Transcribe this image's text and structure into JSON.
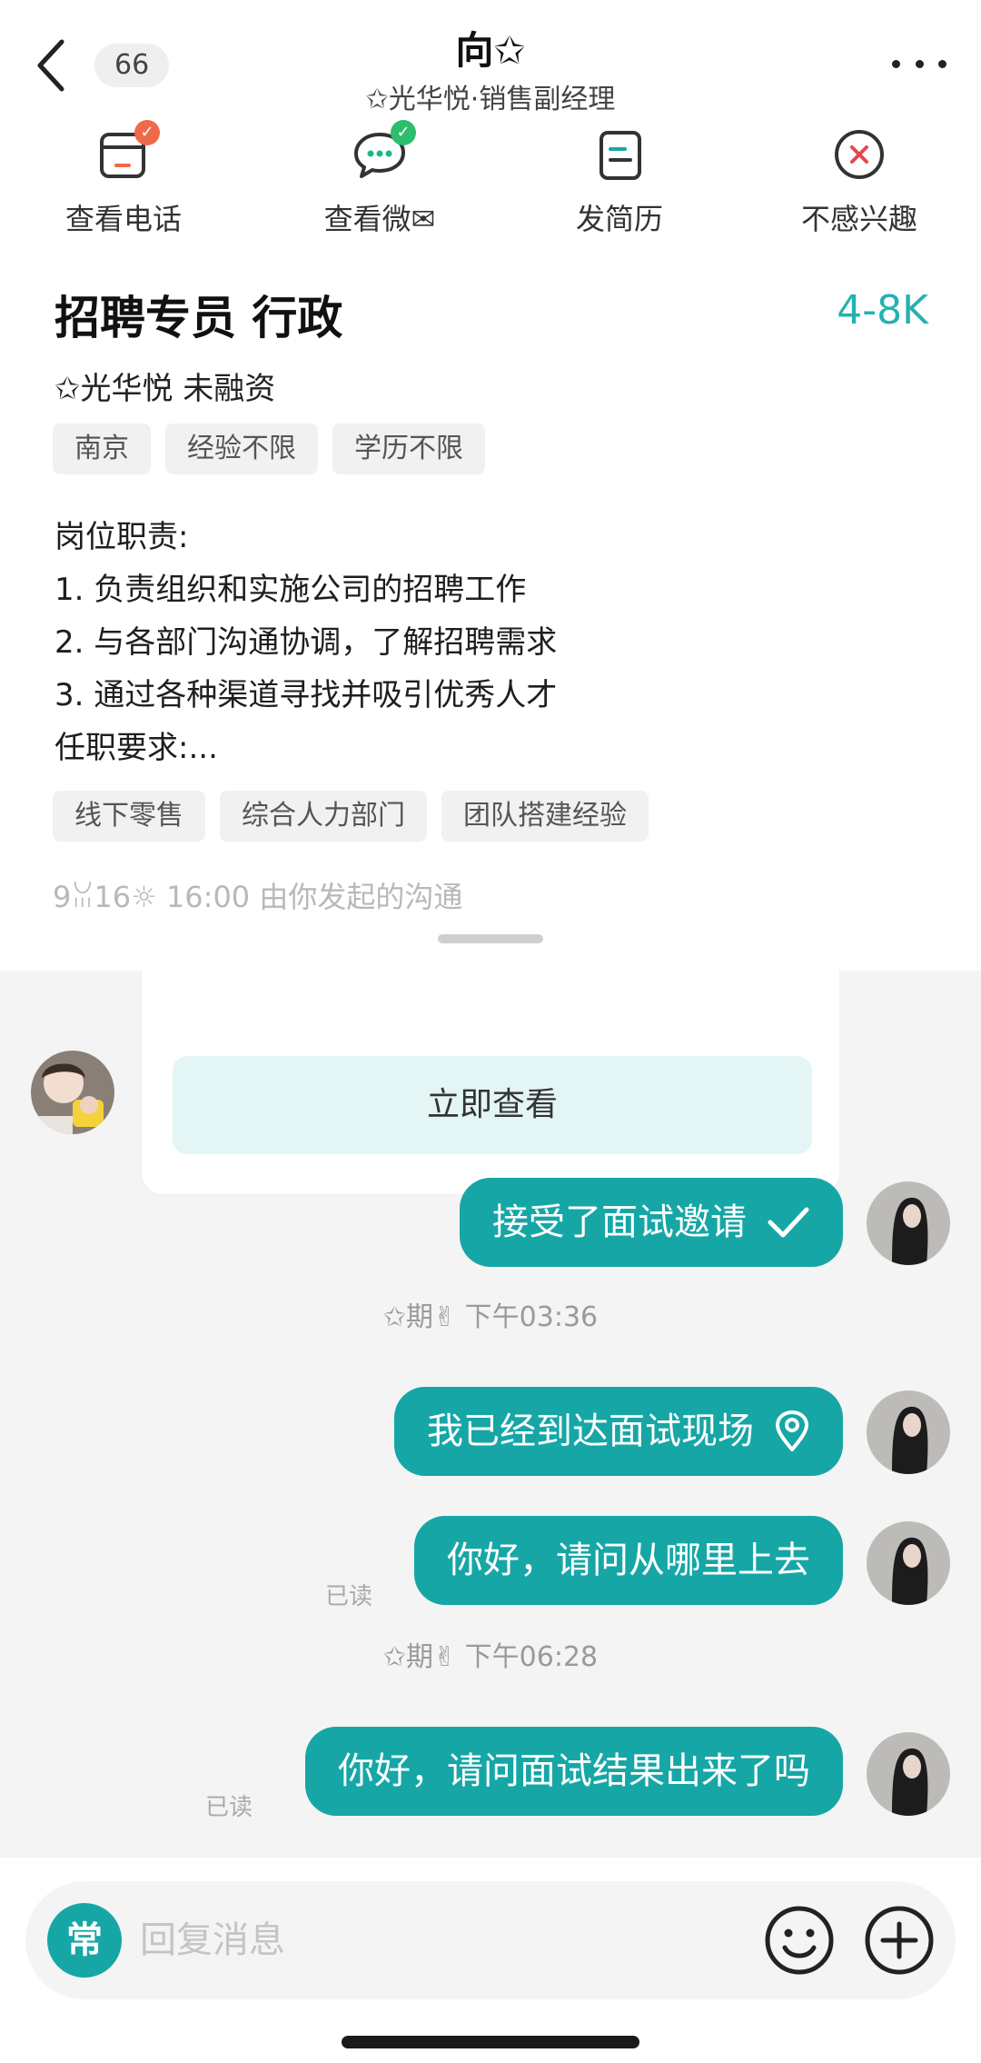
{
  "header": {
    "badge": "66",
    "title": "向✩",
    "subtitle": "✩光华悦·销售副经理"
  },
  "actions": [
    {
      "label": "查看电话"
    },
    {
      "label": "查看微✉"
    },
    {
      "label": "发简历"
    },
    {
      "label": "不感兴趣"
    }
  ],
  "job": {
    "title": "招聘专员 行政",
    "salary": "4-8K",
    "company": "✩光华悦 未融资",
    "tags": [
      "南京",
      "经验不限",
      "学历不限"
    ],
    "desc": [
      "岗位职责:",
      "1. 负责组织和实施公司的招聘工作",
      "2. 与各部门沟通协调，了解招聘需求",
      "3. 通过各种渠道寻找并吸引优秀人才",
      "任职要求:..."
    ],
    "skills": [
      "线下零售",
      "综合人力部门",
      "团队搭建经验"
    ],
    "meta": "9ꈍ16☼ 16:00 由你发起的沟通"
  },
  "chat": {
    "view_button": "立即查看",
    "messages": [
      {
        "text": "接受了面试邀请",
        "icon": "check-icon"
      },
      {
        "time": "✩期✌ 下午03:36"
      },
      {
        "text": "我已经到达面试现场",
        "icon": "location-icon"
      },
      {
        "text": "你好，请问从哪里上去",
        "read": "已读"
      },
      {
        "time": "✩期✌ 下午06:28"
      },
      {
        "text": "你好，请问面试结果出来了吗",
        "read": "已读"
      }
    ]
  },
  "input": {
    "quick_label": "常",
    "placeholder": "回复消息"
  },
  "colors": {
    "accent": "#17a6a6",
    "salary": "#23b2b2",
    "view_button_bg": "#e3f6f5",
    "chat_bg": "#f4f4f4"
  }
}
